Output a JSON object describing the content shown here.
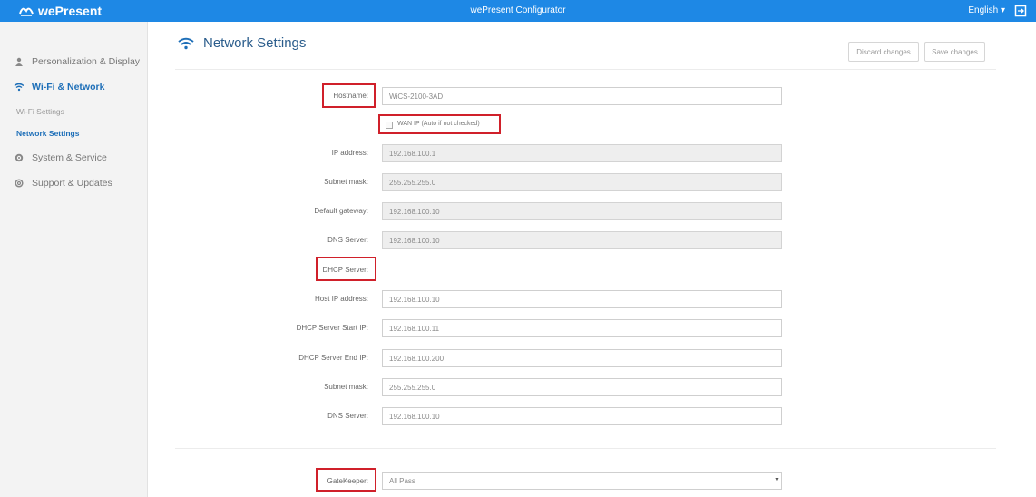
{
  "topbar": {
    "brand": "wePresent",
    "title": "wePresent Configurator",
    "language": "English ▾"
  },
  "sidebar": {
    "items": [
      {
        "label": "Personalization & Display"
      },
      {
        "label": "Wi-Fi & Network"
      },
      {
        "label": "System & Service"
      },
      {
        "label": "Support & Updates"
      }
    ],
    "subitems": [
      {
        "label": "Wi-Fi Settings"
      },
      {
        "label": "Network Settings"
      }
    ]
  },
  "page": {
    "title": "Network Settings",
    "discard_label": "Discard changes",
    "save_label": "Save changes"
  },
  "form": {
    "hostname": {
      "label": "Hostname:",
      "value": "WiCS-2100-3AD"
    },
    "wan_ip": {
      "label": "WAN IP (Auto if not checked)",
      "checked": false
    },
    "ip_address": {
      "label": "IP address:",
      "value": "192.168.100.1"
    },
    "subnet_mask": {
      "label": "Subnet mask:",
      "value": "255.255.255.0"
    },
    "default_gateway": {
      "label": "Default gateway:",
      "value": "192.168.100.10"
    },
    "dns_server": {
      "label": "DNS Server:",
      "value": "192.168.100.10"
    },
    "dhcp_server": {
      "label": "DHCP Server:"
    },
    "host_ip": {
      "label": "Host IP address:",
      "value": "192.168.100.10"
    },
    "dhcp_start": {
      "label": "DHCP Server Start IP:",
      "value": "192.168.100.11"
    },
    "dhcp_end": {
      "label": "DHCP Server End IP:",
      "value": "192.168.100.200"
    },
    "dhcp_subnet": {
      "label": "Subnet mask:",
      "value": "255.255.255.0"
    },
    "dhcp_dns": {
      "label": "DNS Server:",
      "value": "192.168.100.10"
    },
    "gatekeeper": {
      "label": "GateKeeper:",
      "value": "All Pass"
    }
  },
  "colors": {
    "topbar": "#1e88e5",
    "accent": "#1e6fb8",
    "highlight": "#d0202a"
  }
}
